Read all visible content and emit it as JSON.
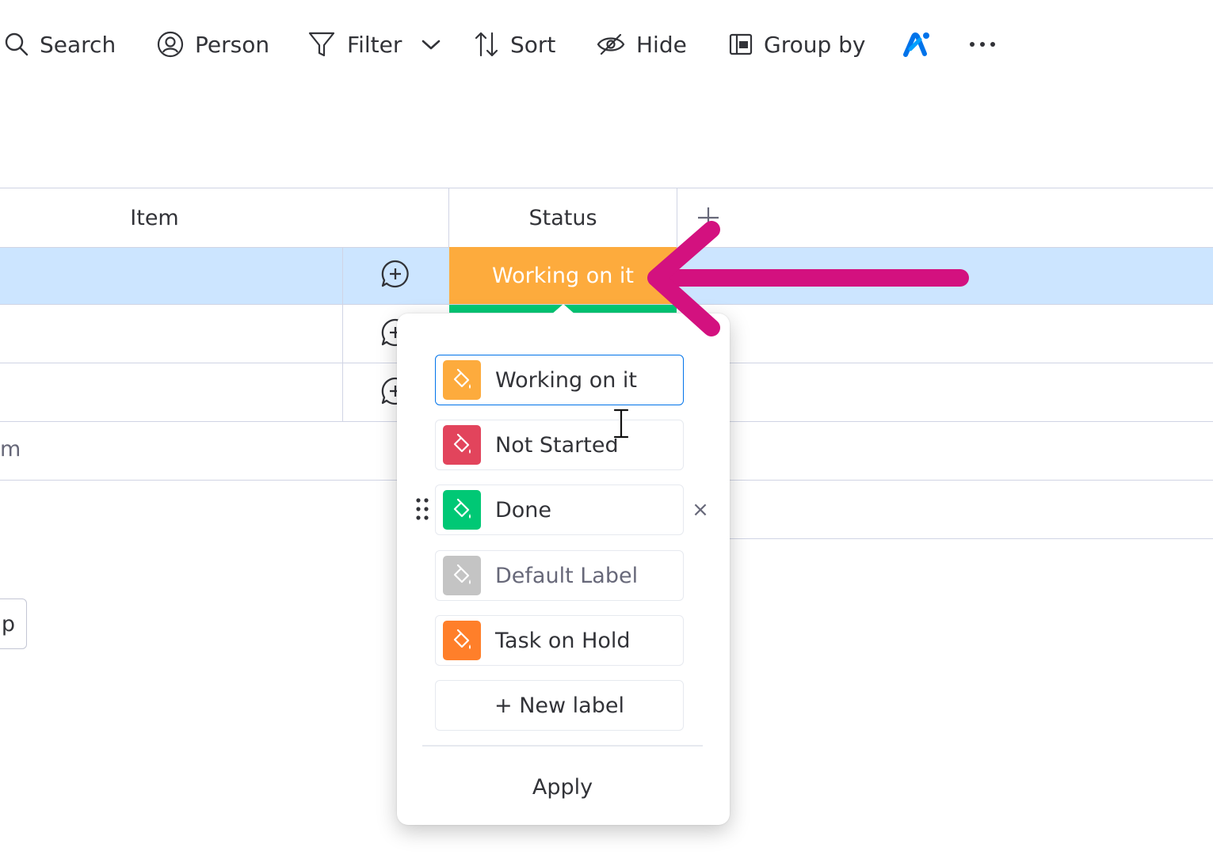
{
  "toolbar": {
    "search_label": "Search",
    "person_label": "Person",
    "filter_label": "Filter",
    "sort_label": "Sort",
    "hide_label": "Hide",
    "group_by_label": "Group by"
  },
  "table": {
    "columns": [
      "Item",
      "Status"
    ],
    "rows": [
      {
        "status": "Working on it"
      }
    ],
    "add_item_partial": "m",
    "add_group_partial": "p"
  },
  "status_popover": {
    "labels": [
      {
        "text": "Working on it",
        "color": "#fdab3d"
      },
      {
        "text": "Not Started",
        "color": "#e2445c"
      },
      {
        "text": "Done",
        "color": "#00c875"
      },
      {
        "text": "Default Label",
        "color": "#c4c4c4"
      },
      {
        "text": "Task on Hold",
        "color": "#ff7f2a"
      }
    ],
    "new_label": "+ New label",
    "apply_label": "Apply"
  },
  "colors": {
    "selected_row": "#cce5ff",
    "annotation_arrow": "#d3117f",
    "ai_icon": "#0073ea"
  }
}
